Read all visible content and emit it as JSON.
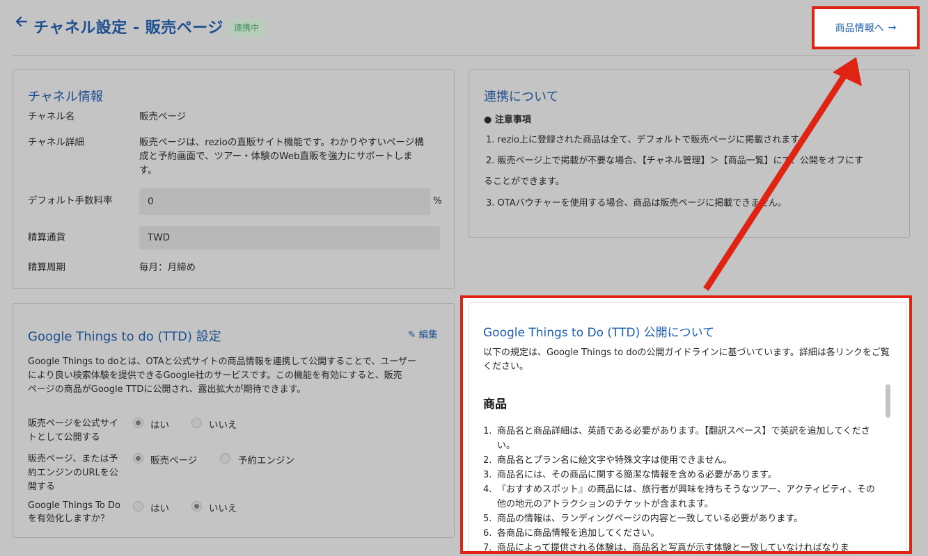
{
  "header": {
    "title": "チャネル設定  - 販売ページ",
    "status_badge": "連携中",
    "next_label": "商品情報へ",
    "next_arrow": "→",
    "back_icon": "arrow-left-icon"
  },
  "channel_info": {
    "title": "チャネル情報",
    "name_label": "チャネル名",
    "name_value": "販売ページ",
    "detail_label": "チャネル詳細",
    "detail_line1": "販売ページは、rezioの直販サイト機能です。わかりやすいページ構",
    "detail_line2": "成と予約画面で、ツアー・体験のWeb直販を強力にサポートしま",
    "detail_line3": "す。",
    "fee_label": "デフォルト手数料率",
    "fee_value": "0",
    "fee_unit": "%",
    "currency_label": "精算通貨",
    "currency_value": "TWD",
    "cycle_label": "精算周期",
    "cycle_value": "毎月：月締め"
  },
  "about": {
    "title": "連携について",
    "notice_heading": "●  注意事項",
    "items": [
      "1. rezio上に登録された商品は全て、デフォルトで販売ページに掲載されます。",
      "2. 販売ページ上で掲載が不要な場合、【チャネル管理】＞【商品一覧】にて、公開をオフにす",
      "ることができます。",
      "3. OTAバウチャーを使用する場合、商品は販売ページに掲載できません。"
    ]
  },
  "ttd_settings": {
    "title": "Google Things to do (TTD) 設定",
    "edit_label": "編集",
    "desc_line1": "Google Things to doとは、OTAと公式サイトの商品情報を連携して公開することで、ユーザー",
    "desc_line2": "により良い検索体験を提供できるGoogle社のサービスです。この機能を有効にすると、販売",
    "desc_line3": "ページの商品がGoogle TTDに公開され、露出拡大が期待できます。",
    "q1_line1": "販売ページを公式サイ",
    "q1_line2": "トとして公開する",
    "q1_opt_yes": "はい",
    "q1_opt_no": "いいえ",
    "q2_line1": "販売ページ、または予",
    "q2_line2": "約エンジンのURLを公",
    "q2_line3": "開する",
    "q2_opt_a": "販売ページ",
    "q2_opt_b": "予約エンジン",
    "q3_line1": "Google Things To Do",
    "q3_line2": "を有効化しますか？",
    "q3_opt_yes": "はい",
    "q3_opt_no": "いいえ"
  },
  "ttd_publish": {
    "title": "Google Things to Do (TTD) 公開について",
    "desc": "以下の規定は、Google Things to doの公開ガイドラインに基づいています。詳細は各リンクをご覧ください。",
    "section": "商品",
    "items": [
      {
        "num": "1.",
        "text": "商品名と商品詳細は、英語である必要があります。【翻訳スペース】で英訳を追加してください。"
      },
      {
        "num": "2.",
        "text": "商品名とプラン名に絵文字や特殊文字は使用できません。"
      },
      {
        "num": "3.",
        "text": "商品名には、その商品に関する簡潔な情報を含める必要があります。"
      },
      {
        "num": "4.",
        "text": "『おすすめスポット』の商品には、旅行者が興味を持ちそうなツアー、アクティビティ、その他の地元のアトラクションのチケットが含まれます。"
      },
      {
        "num": "5.",
        "text": "商品の情報は、ランディングページの内容と一致している必要があります。"
      },
      {
        "num": "6.",
        "text": "各商品に商品情報を追加してください。"
      },
      {
        "num": "7.",
        "text": "商品によって提供される体験は、商品名と写真が示す体験と一致していなければなりま"
      }
    ]
  },
  "colors": {
    "highlight": "#e02414",
    "title_blue": "#1f4f8f",
    "link_blue": "#1f5fb0"
  }
}
